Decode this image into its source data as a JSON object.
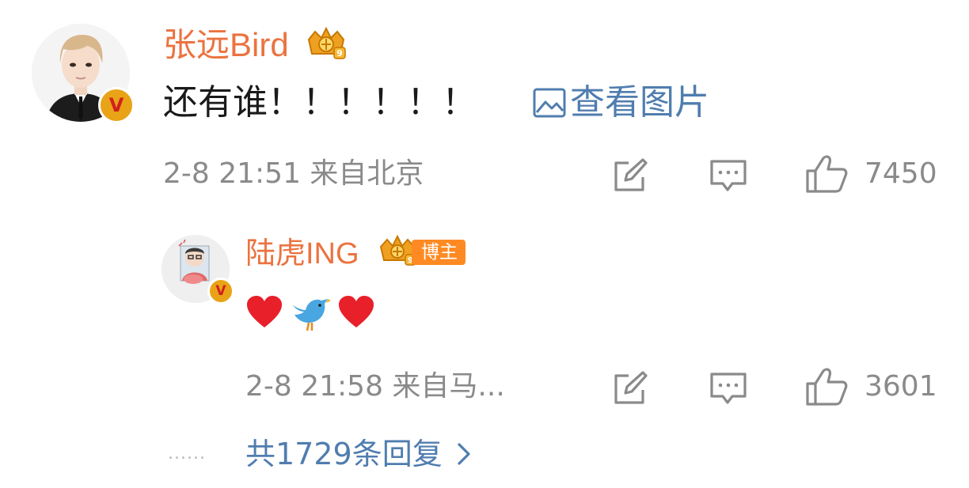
{
  "comment": {
    "username": "张远Bird",
    "text": "还有谁！！！！！！",
    "view_image_label": "查看图片",
    "meta": "2-8 21:51 来自北京",
    "like_count": "7450",
    "verified_badge": "V"
  },
  "reply": {
    "username": "陆虎ING",
    "author_badge": "博主",
    "content_icons": [
      "red-heart",
      "blue-bird",
      "red-heart"
    ],
    "meta": "2-8 21:58 来自马...",
    "like_count": "3601",
    "verified_badge": "V"
  },
  "more": {
    "dots": "......",
    "label": "共1729条回复"
  },
  "colors": {
    "username": "#eb7340",
    "link": "#507daf",
    "meta": "#8a8a8a",
    "badge_orange": "#ff8a23",
    "verified_gold": "#e8a317"
  }
}
